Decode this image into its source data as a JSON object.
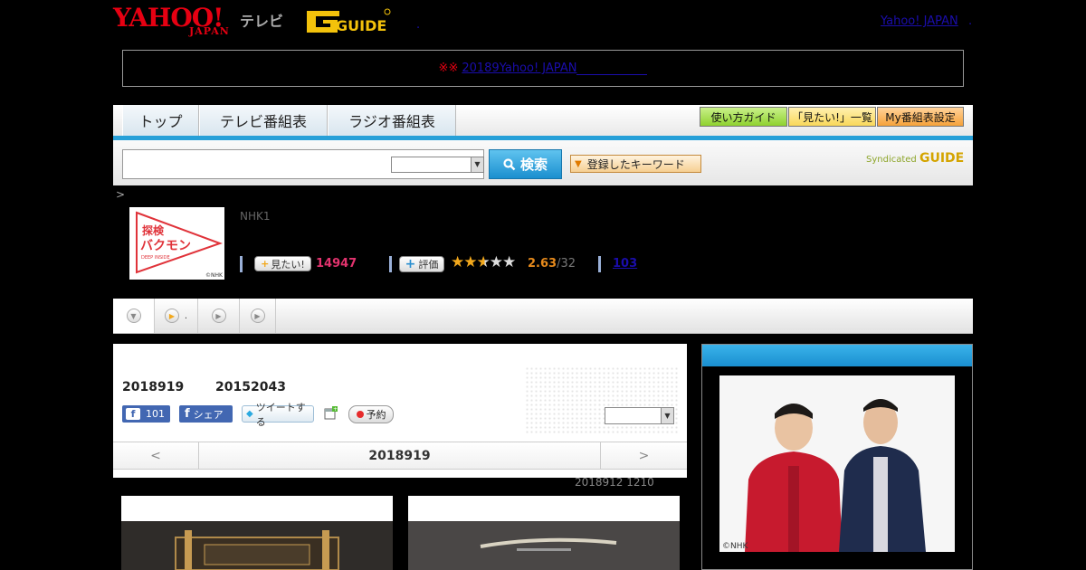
{
  "header": {
    "yahoo_logo": "YAHOO!",
    "yahoo_sub": "JAPAN",
    "tv_label": "テレビ",
    "gguide_logo": "G GUIDE",
    "link_yahoo": "Yahoo! JAPAN",
    "dot1": ".",
    "dot2": "."
  },
  "notice": {
    "mark": "※※",
    "link": "20189Yahoo! JAPAN"
  },
  "nav": {
    "tabs": [
      "トップ",
      "テレビ番組表",
      "ラジオ番組表"
    ],
    "buttons": [
      {
        "label": "使い方ガイド",
        "color": "#8fd22f"
      },
      {
        "label": "「見たい!」一覧",
        "color": "#f9d85a"
      },
      {
        "label": "My番組表設定",
        "color": "#f6a23a"
      }
    ]
  },
  "search": {
    "input_value": "",
    "select_value": "",
    "button_label": "検索",
    "keyword_button": "登録したキーワード",
    "syndicated_label": "Syndicated",
    "syndicated_logo": "GUIDE"
  },
  "program": {
    "breadcrumb": ">",
    "image_text": {
      "line1": "探検",
      "line2": "バクモン",
      "line3": "DEEP INSIDE",
      "copyright": "©NHK"
    },
    "channel": "NHK1",
    "mitai_label": "見たい!",
    "mitai_count": "14947",
    "eval_label": "評価",
    "stars": 2.63,
    "rating": "2.63",
    "rating_of": "/32",
    "review_count": "103"
  },
  "subnav": {
    "tab2_label": "."
  },
  "episode": {
    "date": "2018919",
    "time": "20152043",
    "fb_like": "101",
    "fb_share": "シェア",
    "tweet": "ツイートする",
    "yoyaku": "予約",
    "select_value": ""
  },
  "datebar": {
    "prev": "<",
    "current": "2018919",
    "next": ">"
  },
  "update_note": "2018912  1210",
  "sidebar": {
    "copyright": "©NHK"
  },
  "colors": {
    "accent_blue": "#27a0d8",
    "mitai_pink": "#e2336e",
    "rating_orange": "#e68a1c",
    "yahoo_red": "#e60012"
  }
}
